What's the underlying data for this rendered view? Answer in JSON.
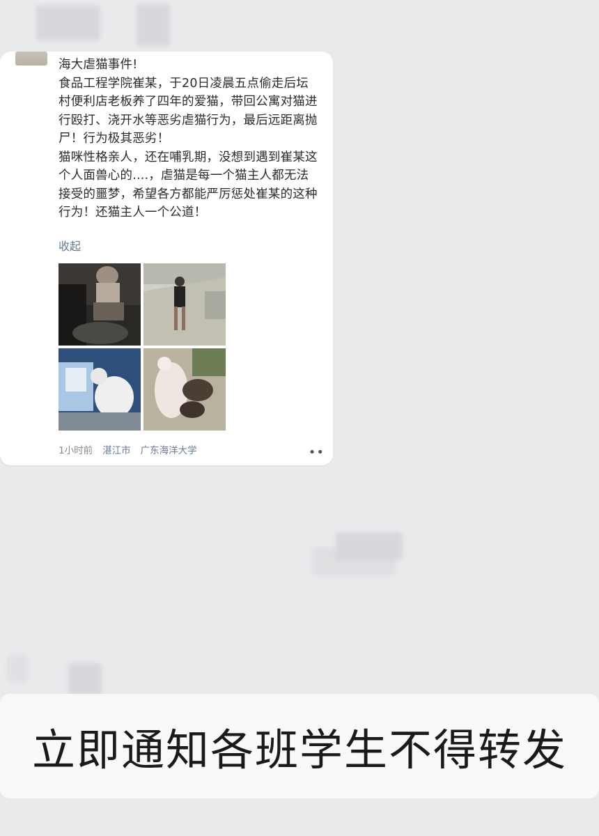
{
  "post": {
    "title": "海大虐猫事件!",
    "body": "食品工程学院崔某，于20日凌晨五点偷走后坛村便利店老板养了四年的爱猫，带回公寓对猫进行殴打、浇开水等恶劣虐猫行为，最后远距离抛尸！行为极其恶劣！\n猫咪性格亲人，还在哺乳期，没想到遇到崔某这个人面兽心的....，虐猫是每一个猫主人都无法接受的噩梦，希望各方都能严厉惩处崔某的这种行为！还猫主人一个公道！",
    "collapse_label": "收起",
    "time": "1小时前",
    "location_city": "湛江市",
    "location_school": "广东海洋大学",
    "more_icon": "more-icon"
  },
  "caption": {
    "text": "立即通知各班学生不得转发"
  },
  "colors": {
    "background": "#e9eaec",
    "card": "#ffffff",
    "link": "#6a7a95"
  }
}
